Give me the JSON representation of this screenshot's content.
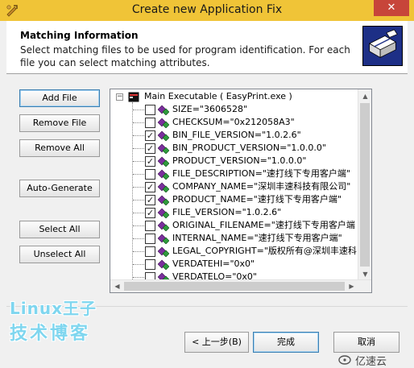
{
  "window": {
    "title": "Create new Application Fix",
    "close_glyph": "✕"
  },
  "header": {
    "heading": "Matching Information",
    "description": "Select matching files to be used for program identification. For each file you can select matching attributes."
  },
  "left_buttons": {
    "add_file": "Add File",
    "remove_file": "Remove File",
    "remove_all": "Remove All",
    "auto_generate": "Auto-Generate",
    "select_all": "Select All",
    "unselect_all": "Unselect All"
  },
  "tree": {
    "expander": "−",
    "root_label": "Main Executable ( EasyPrint.exe )",
    "items": [
      {
        "label": "SIZE=\"3606528\"",
        "checked": false
      },
      {
        "label": "CHECKSUM=\"0x212058A3\"",
        "checked": false
      },
      {
        "label": "BIN_FILE_VERSION=\"1.0.2.6\"",
        "checked": true
      },
      {
        "label": "BIN_PRODUCT_VERSION=\"1.0.0.0\"",
        "checked": true
      },
      {
        "label": "PRODUCT_VERSION=\"1.0.0.0\"",
        "checked": true
      },
      {
        "label": "FILE_DESCRIPTION=\"速打线下专用客户端\"",
        "checked": false
      },
      {
        "label": "COMPANY_NAME=\"深圳丰速科技有限公司\"",
        "checked": true
      },
      {
        "label": "PRODUCT_NAME=\"速打线下专用客户端\"",
        "checked": true
      },
      {
        "label": "FILE_VERSION=\"1.0.2.6\"",
        "checked": true
      },
      {
        "label": "ORIGINAL_FILENAME=\"速打线下专用客户端",
        "checked": false
      },
      {
        "label": "INTERNAL_NAME=\"速打线下专用客户端\"",
        "checked": false
      },
      {
        "label": "LEGAL_COPYRIGHT=\"版权所有@深圳丰速科",
        "checked": false
      },
      {
        "label": "VERDATEHI=\"0x0\"",
        "checked": false
      },
      {
        "label": "VERDATELO=\"0x0\"",
        "checked": false
      }
    ],
    "check_glyph": "✓"
  },
  "footer": {
    "back": "< 上一步(B)",
    "finish": "完成",
    "cancel": "取消"
  },
  "watermarks": {
    "line1": "Linux王子",
    "line2": "技术博客",
    "site": "亿速云"
  },
  "colors": {
    "titlebar": "#f0c437",
    "close": "#c7453a",
    "logo_bg": "#1d2f86",
    "watermark": "#7fd6ef"
  }
}
